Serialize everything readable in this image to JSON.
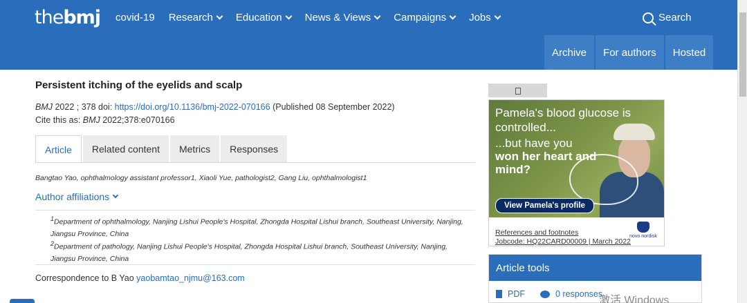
{
  "header": {
    "logo_the": "the",
    "logo_bmj": "bmj",
    "nav": [
      {
        "label": "covid-19"
      },
      {
        "label": "Research"
      },
      {
        "label": "Education"
      },
      {
        "label": "News & Views"
      },
      {
        "label": "Campaigns"
      },
      {
        "label": "Jobs"
      }
    ],
    "search_label": "Search",
    "subnav": [
      "Archive",
      "For authors",
      "Hosted"
    ]
  },
  "article": {
    "title": "Persistent itching of the eyelids and scalp",
    "journal": "BMJ",
    "year_vol": " 2022 ; 378  doi: ",
    "doi": "https://doi.org/10.1136/bmj-2022-070166",
    "published": " (Published 08 September 2022)",
    "cite_prefix": "Cite this as: ",
    "cite_journal": "BMJ",
    "cite_ref": " 2022;378:e070166",
    "tabs": [
      "Article",
      "Related content",
      "Metrics",
      "Responses"
    ],
    "authors": "Bangtao Yao, ophthalmology assistant professor1,  Xiaoli Yue, pathologist2,  Gang Liu, ophthalmologist1",
    "affil_toggle": "Author affiliations",
    "affiliations": [
      {
        "num": "1",
        "text": "Department of ophthalmology, Nanjing Lishui People's Hospital, Zhongda Hospital Lishui branch, Southeast University, Nanjing, Jiangsu Province, China"
      },
      {
        "num": "2",
        "text": "Department of pathology, Nanjing Lishui People's Hospital, Zhongda Hospital Lishui branch, Southeast University, Nanjing, Jiangsu Province, China"
      }
    ],
    "corr_prefix": "Correspondence to B Yao ",
    "corr_email": "yaobamtao_njmu@163.com"
  },
  "ad": {
    "headline": "Pamela's blood glucose is controlled...",
    "sub1": "...but have you",
    "sub2": "won her heart and mind?",
    "button": "View Pamela's profile",
    "refs": "References and footnotes",
    "jobcode": "Jobcode: HQ22CARD00009 | March 2022",
    "brand": "novo nordisk"
  },
  "tools": {
    "title": "Article tools",
    "pdf": "PDF",
    "responses": "0 responses"
  },
  "watermark": "激活 Windows"
}
